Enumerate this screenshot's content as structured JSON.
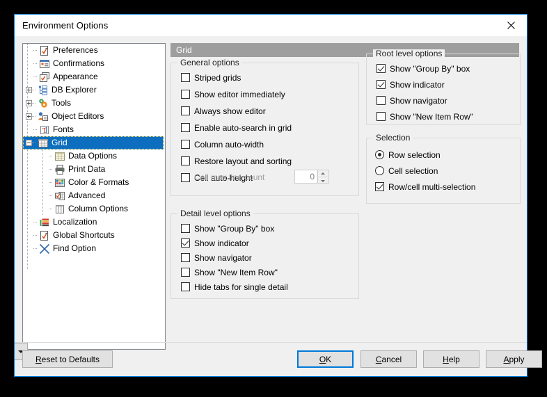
{
  "window": {
    "title": "Environment Options",
    "close_icon": "close-icon",
    "accent_color": "#0078d7"
  },
  "tree": {
    "selected": "Grid",
    "items": [
      {
        "label": "Preferences",
        "icon": "preferences-icon",
        "depth": 1,
        "expander": "none"
      },
      {
        "label": "Confirmations",
        "icon": "confirmations-icon",
        "depth": 1,
        "expander": "none"
      },
      {
        "label": "Appearance",
        "icon": "appearance-icon",
        "depth": 1,
        "expander": "none"
      },
      {
        "label": "DB Explorer",
        "icon": "db-explorer-icon",
        "depth": 1,
        "expander": "plus"
      },
      {
        "label": "Tools",
        "icon": "tools-icon",
        "depth": 1,
        "expander": "plus"
      },
      {
        "label": "Object Editors",
        "icon": "object-editors-icon",
        "depth": 1,
        "expander": "plus"
      },
      {
        "label": "Fonts",
        "icon": "fonts-icon",
        "depth": 1,
        "expander": "none"
      },
      {
        "label": "Grid",
        "icon": "grid-icon",
        "depth": 1,
        "expander": "minus",
        "selected": true
      },
      {
        "label": "Data Options",
        "icon": "data-options-icon",
        "depth": 2,
        "expander": "none"
      },
      {
        "label": "Print Data",
        "icon": "print-data-icon",
        "depth": 2,
        "expander": "none"
      },
      {
        "label": "Color & Formats",
        "icon": "color-formats-icon",
        "depth": 2,
        "expander": "none"
      },
      {
        "label": "Advanced",
        "icon": "advanced-icon",
        "depth": 2,
        "expander": "none"
      },
      {
        "label": "Column Options",
        "icon": "column-options-icon",
        "depth": 2,
        "expander": "none"
      },
      {
        "label": "Localization",
        "icon": "localization-icon",
        "depth": 1,
        "expander": "none"
      },
      {
        "label": "Global Shortcuts",
        "icon": "global-shortcuts-icon",
        "depth": 1,
        "expander": "none"
      },
      {
        "label": "Find Option",
        "icon": "find-option-icon",
        "depth": 1,
        "expander": "none"
      }
    ]
  },
  "page": {
    "header": "Grid",
    "general": {
      "title": "General options",
      "options": [
        {
          "label": "Striped grids",
          "checked": false,
          "acc_index": 8
        },
        {
          "label": "Show editor immediately",
          "checked": false
        },
        {
          "label": "Always show editor",
          "checked": false
        },
        {
          "label": "Enable auto-search in grid",
          "checked": false
        },
        {
          "label": "Column auto-width",
          "checked": false
        },
        {
          "label": "Restore layout and sorting",
          "checked": false
        },
        {
          "label": "Cell auto-height",
          "checked": false
        }
      ],
      "cell_max_line_count": {
        "label": "Cell max line count",
        "value": "0",
        "disabled": true
      }
    },
    "detail": {
      "title": "Detail level options",
      "options": [
        {
          "label": "Show \"Group By\" box",
          "checked": false
        },
        {
          "label": "Show indicator",
          "checked": true
        },
        {
          "label": "Show navigator",
          "checked": false
        },
        {
          "label": "Show \"New Item Row\"",
          "checked": false
        },
        {
          "label": "Hide tabs for single detail",
          "checked": false
        }
      ]
    },
    "root": {
      "title": "Root level options",
      "options": [
        {
          "label": "Show \"Group By\" box",
          "checked": true
        },
        {
          "label": "Show indicator",
          "checked": true
        },
        {
          "label": "Show navigator",
          "checked": false
        },
        {
          "label": "Show \"New Item Row\"",
          "checked": false
        }
      ]
    },
    "selection": {
      "title": "Selection",
      "radios": [
        {
          "label": "Row selection",
          "checked": true
        },
        {
          "label": "Cell selection",
          "checked": false
        }
      ],
      "checkbox": {
        "label": "Row/cell multi-selection",
        "checked": true
      }
    }
  },
  "footer": {
    "reset": {
      "label": "Reset to Defaults",
      "acc_index": 0
    },
    "reset_dropdown_icon": "chevron-down-icon",
    "buttons": [
      {
        "label": "OK",
        "acc_index": 0,
        "default": true
      },
      {
        "label": "Cancel",
        "acc_index": 0
      },
      {
        "label": "Help",
        "acc_index": 0
      },
      {
        "label": "Apply",
        "acc_index": 0
      }
    ]
  }
}
